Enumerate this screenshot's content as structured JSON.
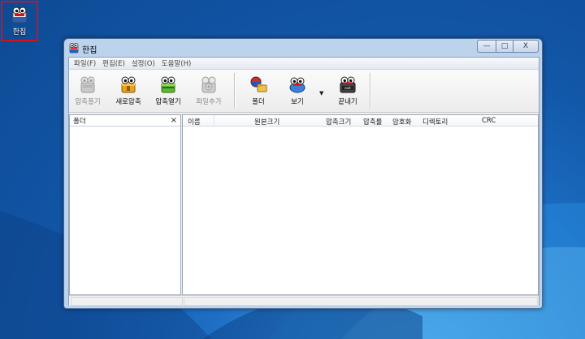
{
  "desktop": {
    "icon_label": "한집"
  },
  "window": {
    "title": "한집",
    "controls": {
      "minimize": "—",
      "maximize": "□",
      "close": "X"
    }
  },
  "menu": {
    "items": [
      {
        "label": "파일(F)"
      },
      {
        "label": "편집(E)"
      },
      {
        "label": "설정(O)"
      },
      {
        "label": "도움말(H)"
      }
    ]
  },
  "toolbar": {
    "buttons": [
      {
        "label": "압축풀기",
        "icon": "extract-icon",
        "enabled": false
      },
      {
        "label": "새로압축",
        "icon": "new-archive-icon",
        "enabled": true
      },
      {
        "label": "압축열기",
        "icon": "open-archive-icon",
        "enabled": true
      },
      {
        "label": "파일추가",
        "icon": "add-file-icon",
        "enabled": false
      },
      {
        "label": "폴더",
        "icon": "folder-icon",
        "enabled": true
      },
      {
        "label": "보기",
        "icon": "view-icon",
        "enabled": true
      },
      {
        "label": "끝내기",
        "icon": "exit-icon",
        "enabled": true
      }
    ],
    "dropdown_arrow": "▼"
  },
  "folder_pane": {
    "header": "폴더",
    "close": "×"
  },
  "file_list": {
    "columns": [
      "이름",
      "원본크기",
      "압축크기",
      "압축률",
      "암호화",
      "디렉토리",
      "CRC"
    ]
  },
  "colors": {
    "accent_red": "#d0121a",
    "window_frame": "#bcd3ee"
  }
}
